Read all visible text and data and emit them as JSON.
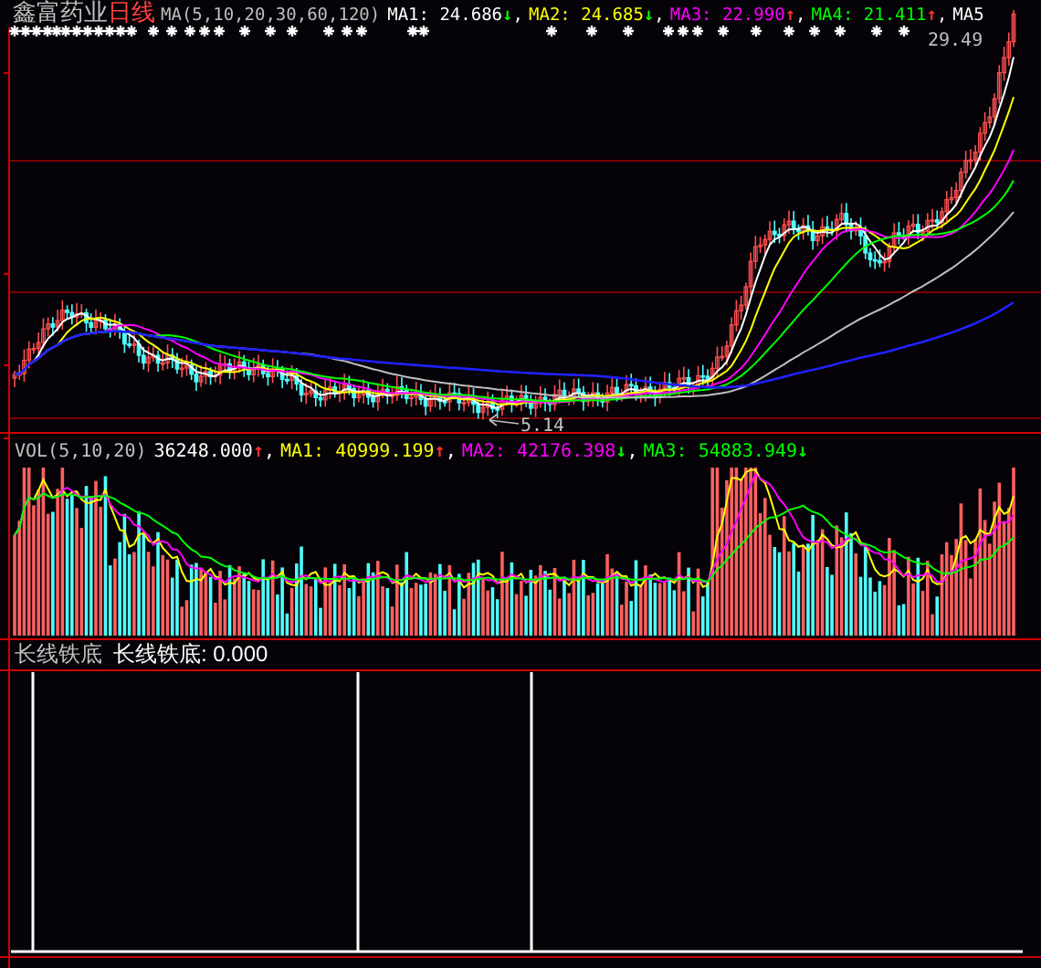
{
  "title": {
    "stock": "鑫富药业",
    "period": "日线"
  },
  "price_pane": {
    "indicator": "MA(5,10,20,30,60,120)",
    "separator": ",",
    "readings": [
      {
        "label": "MA1:",
        "value": "24.686",
        "arrow": {
          "text": "↓",
          "color": "#00ff00"
        },
        "color": "#ffffff"
      },
      {
        "label": "MA2:",
        "value": "24.685",
        "arrow": {
          "text": "↓",
          "color": "#00ff00"
        },
        "color": "#ffff00"
      },
      {
        "label": "MA3:",
        "value": "22.990",
        "arrow": {
          "text": "↑",
          "color": "#ff3030"
        },
        "color": "#ff00ff"
      },
      {
        "label": "MA4:",
        "value": "21.411",
        "arrow": {
          "text": "↑",
          "color": "#ff3030"
        },
        "color": "#00ff00"
      },
      {
        "label": "MA5",
        "color": "#ffffff"
      }
    ],
    "high_label": "29.49",
    "low_label": "5.14"
  },
  "volume_pane": {
    "indicator": "VOL(5,10,20)",
    "separator": ",",
    "readings": [
      {
        "value": "36248.000",
        "arrow": {
          "text": "↑",
          "color": "#ff3030"
        },
        "color": "#ffffff"
      },
      {
        "label": "MA1:",
        "value": "40999.199",
        "arrow": {
          "text": "↑",
          "color": "#ff3030"
        },
        "color": "#ffff00"
      },
      {
        "label": "MA2:",
        "value": "42176.398",
        "arrow": {
          "text": "↓",
          "color": "#00ff00"
        },
        "color": "#ff00ff"
      },
      {
        "label": "MA3:",
        "value": "54883.949",
        "arrow": {
          "text": "↓",
          "color": "#00ff00"
        },
        "color": "#00ff00"
      }
    ]
  },
  "indicator_pane": {
    "name": "长线铁底",
    "reading": "长线铁底: 0.000"
  }
}
